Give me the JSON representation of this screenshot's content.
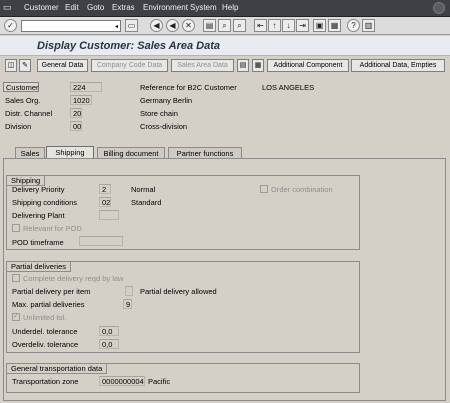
{
  "menu": {
    "items": [
      "Customer",
      "Edit",
      "Goto",
      "Extras",
      "Environment",
      "System",
      "Help"
    ]
  },
  "toolbar": {
    "command_value": "",
    "icons": [
      "enter-icon",
      "save-icon",
      "back-icon",
      "exit-icon",
      "cancel-icon",
      "print-icon",
      "find-icon",
      "find-next-icon",
      "first-page-icon",
      "prev-page-icon",
      "next-page-icon",
      "last-page-icon",
      "new-session-icon",
      "shortcut-icon",
      "help-icon",
      "layout-icon"
    ]
  },
  "title": "Display Customer: Sales Area Data",
  "app_toolbar": {
    "general_data": "General Data",
    "company_code_data": "Company Code Data",
    "sales_area_data": "Sales Area Data",
    "additional_component": "Additional Component",
    "additional_data_empties": "Additional Data, Empties"
  },
  "header": {
    "customer": {
      "label": "Customer",
      "value": "224",
      "text": "Reference for B2C Customer",
      "city": "LOS ANGELES"
    },
    "sales_org": {
      "label": "Sales Org.",
      "value": "1020",
      "text": "Germany Berlin"
    },
    "distr_channel": {
      "label": "Distr. Channel",
      "value": "20",
      "text": "Store chain"
    },
    "division": {
      "label": "Division",
      "value": "00",
      "text": "Cross-division"
    }
  },
  "tabs": [
    "Sales",
    "Shipping",
    "Billing document",
    "Partner functions"
  ],
  "active_tab": "Shipping",
  "shipping": {
    "title": "Shipping",
    "delivery_priority": {
      "label": "Delivery Priority",
      "value": "2",
      "text": "Normal"
    },
    "shipping_conditions": {
      "label": "Shipping conditions",
      "value": "02",
      "text": "Standard"
    },
    "delivering_plant": {
      "label": "Delivering Plant",
      "value": ""
    },
    "relevant_for_pod": "Relevant for POD",
    "pod_timeframe": {
      "label": "POD timeframe",
      "value": ""
    },
    "order_combination": "Order combination"
  },
  "partial": {
    "title": "Partial deliveries",
    "complete_delivery": "Complete delivery reqd by law",
    "partial_per_item": {
      "label": "Partial delivery per item",
      "value": "",
      "text": "Partial delivery allowed"
    },
    "max_partial": {
      "label": "Max. partial deliveries",
      "value": "9"
    },
    "unlimited_tol": "Unlimited tol.",
    "underdel": {
      "label": "Underdel. tolerance",
      "value": "0,0"
    },
    "overdeliv": {
      "label": "Overdeliv. tolerance",
      "value": "0,0"
    }
  },
  "transport": {
    "title": "General transportation data",
    "zone": {
      "label": "Transportation zone",
      "value": "0000000004",
      "text": "Pacific"
    }
  }
}
